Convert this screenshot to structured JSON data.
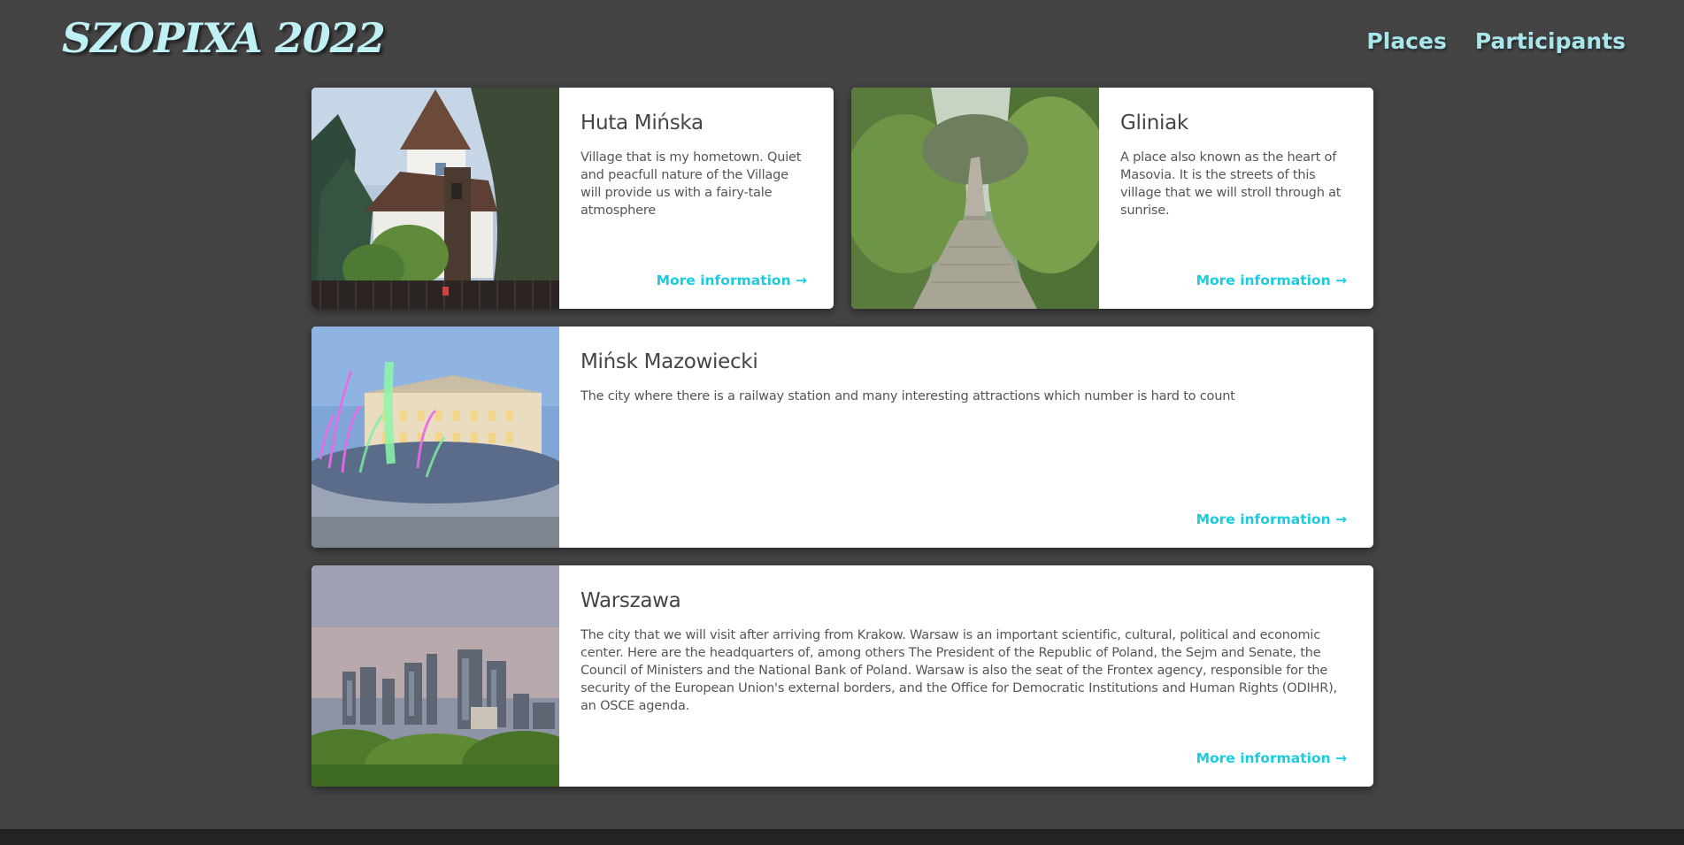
{
  "header": {
    "logo": "SZOPIXA 2022",
    "nav": [
      "Places",
      "Participants"
    ]
  },
  "places": [
    {
      "title": "Huta Mińska",
      "description": "Village that is my hometown. Quiet and peacfull nature of the Village will provide us with a fairy-tale atmosphere",
      "link": "More information →"
    },
    {
      "title": "Gliniak",
      "description": "A place also known as the heart of Masovia. It is the streets of this village that we will stroll through at sunrise.",
      "link": "More information →"
    },
    {
      "title": "Mińsk Mazowiecki",
      "description": "The city where there is a railway station and many interesting attractions which number is hard to count",
      "link": "More information →"
    },
    {
      "title": "Warszawa",
      "description": "The city that we will visit after arriving from Krakow. Warsaw is an important scientific, cultural, political and economic center. Here are the headquarters of, among others The President of the Republic of Poland, the Sejm and Senate, the Council of Ministers and the National Bank of Poland. Warsaw is also the seat of the Frontex agency, responsible for the security of the European Union's external borders, and the Office for Democratic Institutions and Human Rights (ODIHR), an OSCE agenda.",
      "link": "More information →"
    }
  ],
  "colors": {
    "background": "#444444",
    "logo": "#bff0f4",
    "nav": "#a9e6ec",
    "link_accent": "#1ccbde",
    "footer": "#232323"
  }
}
